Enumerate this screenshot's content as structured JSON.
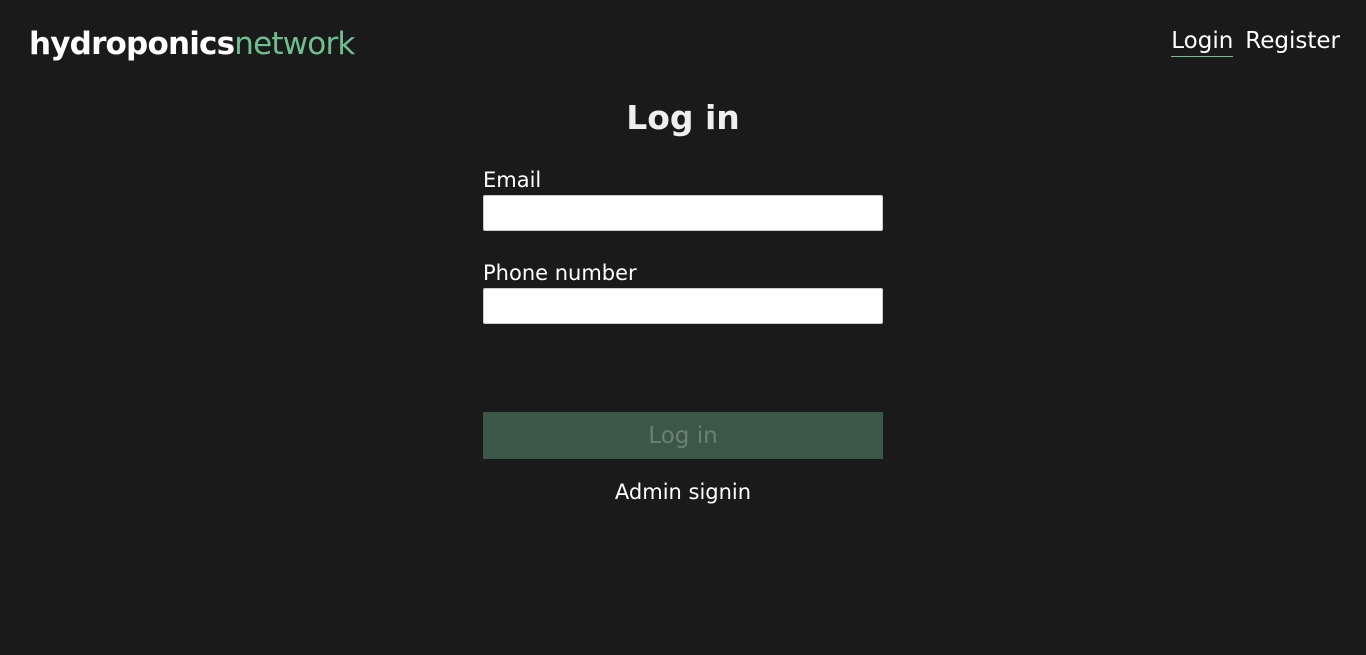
{
  "brand": {
    "part1": "hydroponics",
    "part2": "network",
    "accent_color": "#6fbf8e"
  },
  "nav": {
    "login": "Login",
    "register": "Register"
  },
  "form": {
    "title": "Log in",
    "email_label": "Email",
    "email_value": "",
    "phone_label": "Phone number",
    "phone_value": "",
    "submit_label": "Log in",
    "submit_color": "#3a5747"
  },
  "admin_link": "Admin signin"
}
